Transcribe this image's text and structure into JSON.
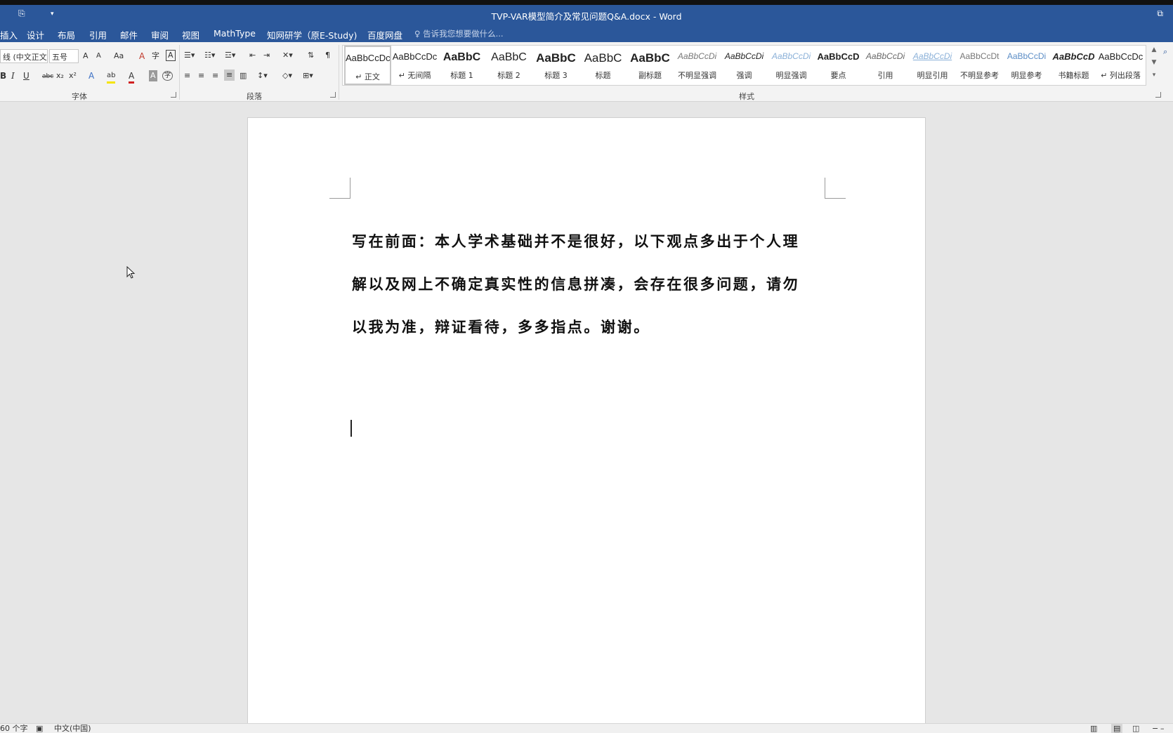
{
  "window": {
    "title": "TVP-VAR模型简介及常见问题Q&A.docx - Word",
    "qa_save": "⎘",
    "qa_customize": "▾",
    "restore": "⧉"
  },
  "tabs": [
    "插入",
    "设计",
    "布局",
    "引用",
    "邮件",
    "审阅",
    "视图",
    "MathType",
    "知网研学（原E-Study)",
    "百度网盘"
  ],
  "tell_me": {
    "placeholder": "告诉我您想要做什么..."
  },
  "ribbon": {
    "font": {
      "label": "字体",
      "name_value": "线 (中文正文",
      "size_value": "五号",
      "grow": "A",
      "shrink": "A",
      "case": "Aa",
      "clear": "A",
      "phonetic": "字",
      "border_char": "A",
      "bold": "B",
      "italic": "I",
      "underline": "U",
      "strike": "abc",
      "sub": "x₂",
      "sup": "x²",
      "effects": "A",
      "highlight": "ab",
      "font_color": "A",
      "shade": "A",
      "enclose": "字"
    },
    "paragraph": {
      "label": "段落"
    },
    "styles": {
      "label": "样式",
      "items": [
        {
          "sample": "AaBbCcDc",
          "name": "↵ 正文"
        },
        {
          "sample": "AaBbCcDc",
          "name": "↵ 无间隔"
        },
        {
          "sample": "AaBbC",
          "name": "标题 1"
        },
        {
          "sample": "AaBbC",
          "name": "标题 2"
        },
        {
          "sample": "AaBbC",
          "name": "标题 3"
        },
        {
          "sample": "AaBbC",
          "name": "标题"
        },
        {
          "sample": "AaBbC",
          "name": "副标题"
        },
        {
          "sample": "AaBbCcDi",
          "name": "不明显强调"
        },
        {
          "sample": "AaBbCcDi",
          "name": "强调"
        },
        {
          "sample": "AaBbCcDi",
          "name": "明显强调"
        },
        {
          "sample": "AaBbCcD",
          "name": "要点"
        },
        {
          "sample": "AaBbCcDi",
          "name": "引用"
        },
        {
          "sample": "AaBbCcDi",
          "name": "明显引用"
        },
        {
          "sample": "AaBbCcDt",
          "name": "不明显参考"
        },
        {
          "sample": "AaBbCcDi",
          "name": "明显参考"
        },
        {
          "sample": "AaBbCcD",
          "name": "书籍标题"
        },
        {
          "sample": "AaBbCcDc",
          "name": "↵ 列出段落"
        }
      ]
    }
  },
  "document": {
    "lines": [
      "写在前面：本人学术基础并不是很好，以下观点多出于个人理",
      "解以及网上不确定真实性的信息拼凑，会存在很多问题，请勿",
      "以我为准，辩证看待，多多指点。谢谢。"
    ]
  },
  "status": {
    "word_count": "60 个字",
    "language": "中文(中国)"
  },
  "colors": {
    "titlebar": "#2b579a",
    "ribbon": "#f3f3f3",
    "canvas": "#e6e6e6"
  }
}
